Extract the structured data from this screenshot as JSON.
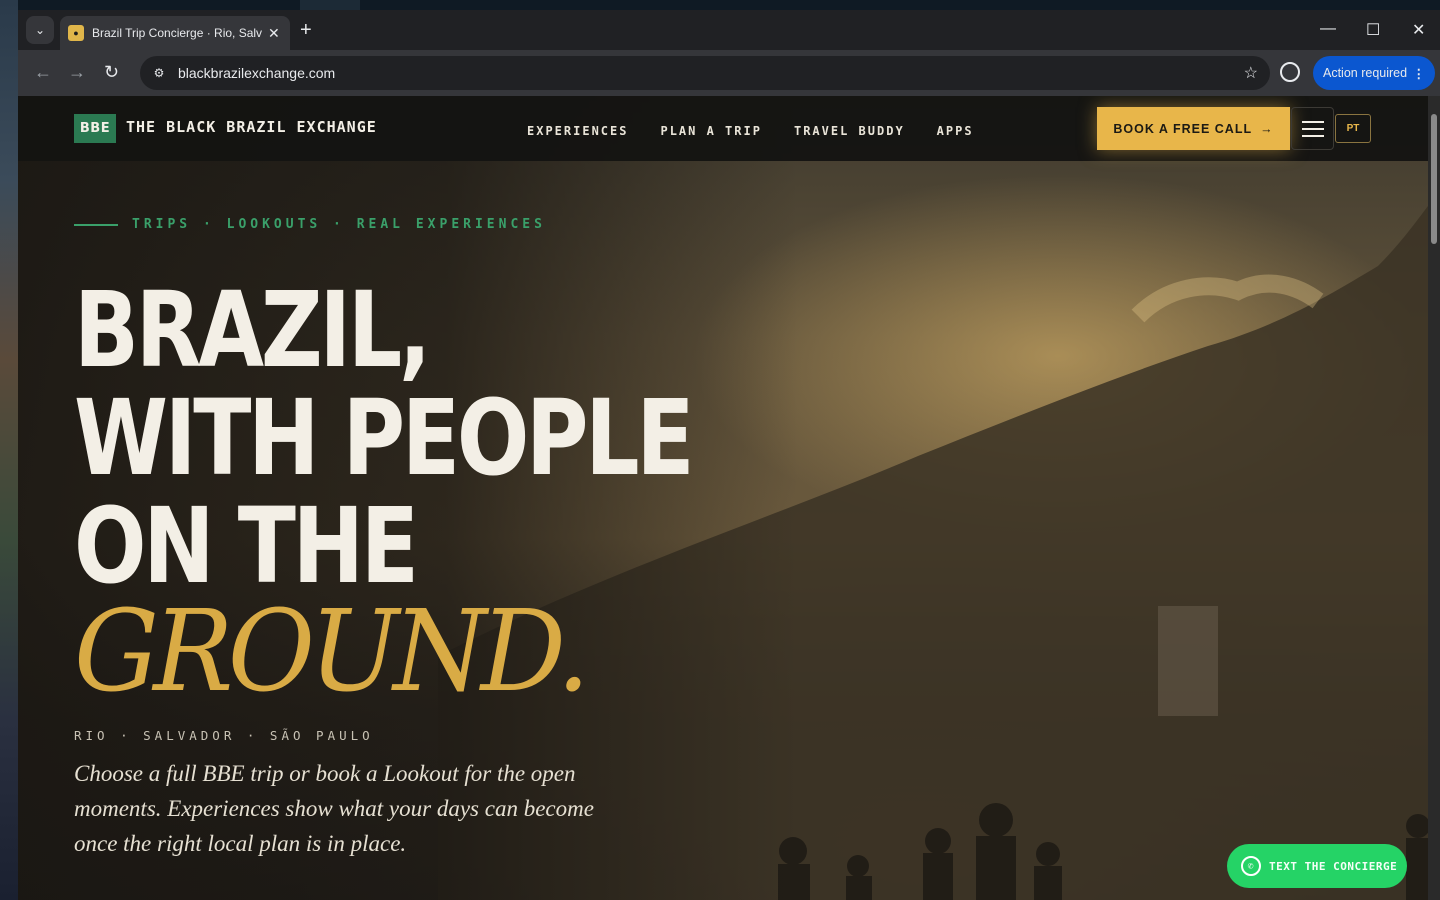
{
  "browser": {
    "tab_title": "Brazil Trip Concierge · Rio, Salva",
    "url": "blackbrazilexchange.com",
    "action_label": "Action required",
    "new_tab": "+",
    "tab_close": "✕",
    "dropdown": "⌄",
    "minimize": "—",
    "maximize": "☐",
    "close": "✕",
    "back": "←",
    "forward": "→",
    "reload": "↻",
    "star": "☆",
    "menu_dots": "⋮"
  },
  "site": {
    "logo_badge": "BBE",
    "logo_text": "THE BLACK BRAZIL EXCHANGE",
    "nav": [
      "EXPERIENCES",
      "PLAN A TRIP",
      "TRAVEL BUDDY",
      "APPS"
    ],
    "cta_label": "BOOK A FREE CALL",
    "cta_arrow": "→",
    "lang": "PT"
  },
  "hero": {
    "eyebrow": "TRIPS · LOOKOUTS · REAL EXPERIENCES",
    "line1": "BRAZIL,",
    "line2": "WITH PEOPLE",
    "line3": "ON THE",
    "line4": "GROUND.",
    "cities": "RIO · SALVADOR · SÃO PAULO",
    "lede": "Choose a full BBE trip or book a Lookout for the open moments. Experiences show what your days can become once the right local plan is in place."
  },
  "whatsapp": {
    "label": "TEXT THE CONCIERGE"
  },
  "colors": {
    "accent_gold": "#e8b64a",
    "accent_green": "#3aa06a",
    "whatsapp_green": "#25d366",
    "chrome_blue": "#0b57d0"
  }
}
